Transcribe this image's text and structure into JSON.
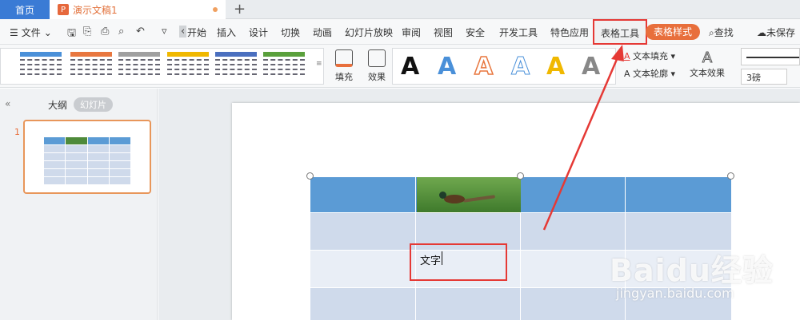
{
  "tabs": {
    "home": "首页",
    "document": "演示文稿1",
    "document_icon": "P",
    "new_tab": "+"
  },
  "menu": {
    "file_label": "文件",
    "items": [
      "开始",
      "插入",
      "设计",
      "切换",
      "动画",
      "幻灯片放映",
      "审阅",
      "视图",
      "安全",
      "开发工具",
      "特色应用",
      "表格工具",
      "表格样式"
    ],
    "find": "查找",
    "save_status": "未保存"
  },
  "ribbon": {
    "fill_label": "填充",
    "effect_label": "效果",
    "wordart_letter": "A",
    "wordart_colors": [
      "#111111",
      "#4a90d9",
      "#e8773f",
      "#ffffff",
      "#f0b800",
      "#888888"
    ],
    "text_fill": "文本填充",
    "text_outline": "文本轮廓",
    "text_effect": "文本效果",
    "line_weight": "3磅",
    "table_style_colors": [
      "#4a90d9",
      "#e8773f",
      "#a0a0a0",
      "#f0b800",
      "#4a6fbf",
      "#5aa03c"
    ]
  },
  "side_panel": {
    "outline_tab": "大纲",
    "slides_tab": "幻灯片",
    "slide_number": "1"
  },
  "slide": {
    "cell_text": "文字"
  },
  "watermark": {
    "brand": "Baidu经验",
    "url": "jingyan.baidu.com"
  }
}
